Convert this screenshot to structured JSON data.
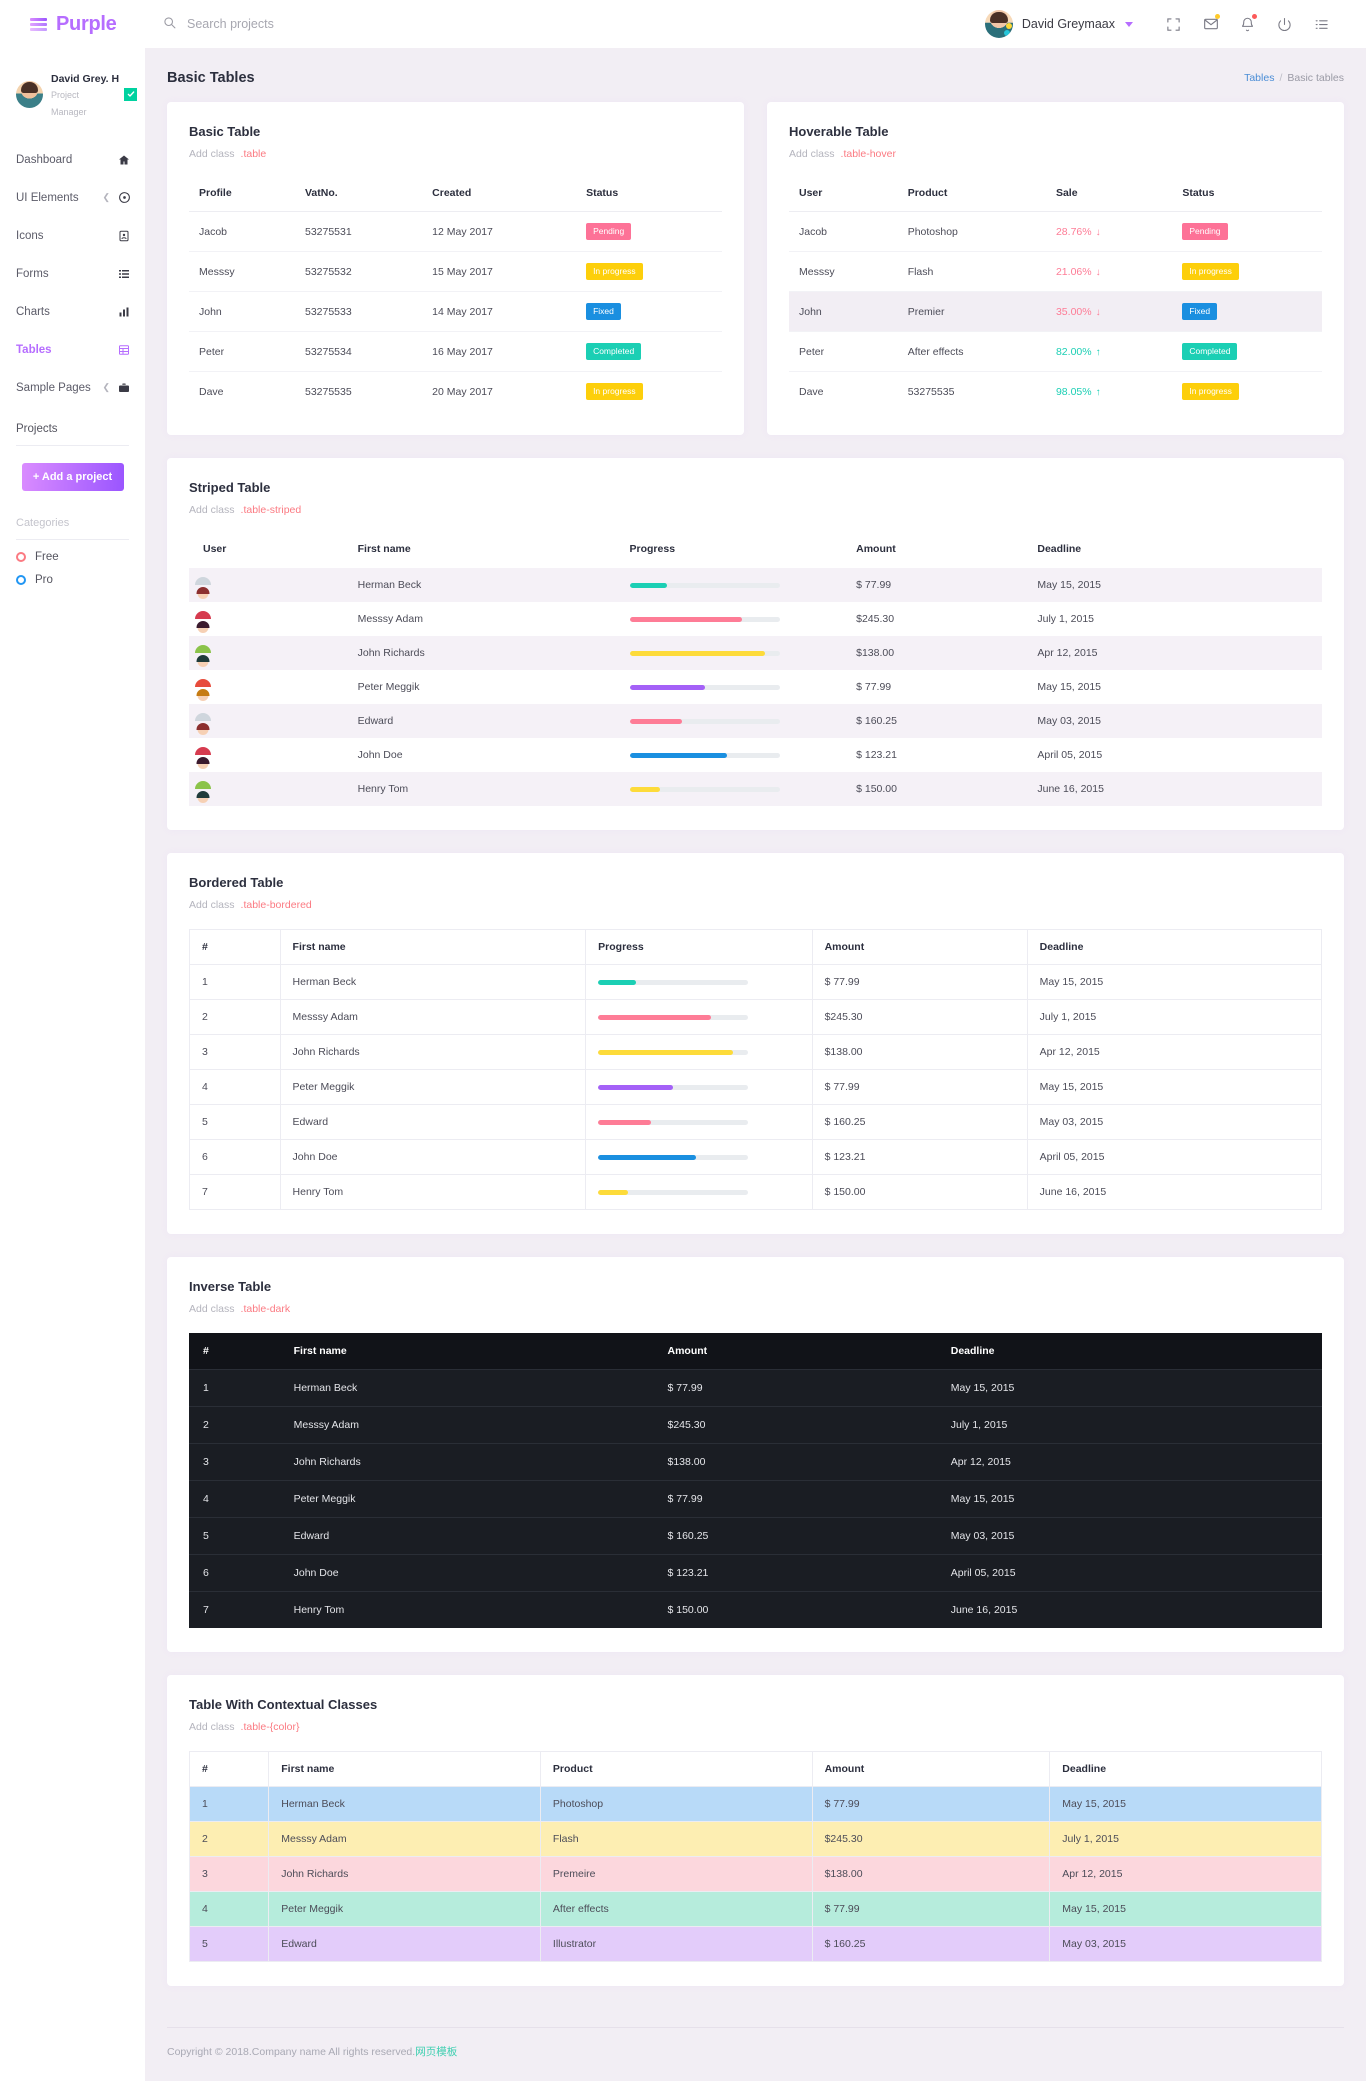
{
  "brand": {
    "name": "Purple"
  },
  "navbar": {
    "search_placeholder": "Search projects",
    "search_value": "",
    "user_name": "David Greymaax",
    "icons": [
      {
        "name": "fullscreen-icon"
      },
      {
        "name": "email-icon",
        "dot": "#ffca2a"
      },
      {
        "name": "bell-icon",
        "dot": "#fc5a5a"
      },
      {
        "name": "power-icon"
      },
      {
        "name": "list-icon"
      }
    ]
  },
  "sidebar": {
    "profile": {
      "name": "David Grey. H",
      "role": "Project Manager"
    },
    "items": [
      {
        "label": "Dashboard",
        "icon": "home-icon",
        "active": false,
        "arrow": false
      },
      {
        "label": "UI Elements",
        "icon": "compass-icon",
        "active": false,
        "arrow": true
      },
      {
        "label": "Icons",
        "icon": "contact-icon",
        "active": false,
        "arrow": false
      },
      {
        "label": "Forms",
        "icon": "form-icon",
        "active": false,
        "arrow": false
      },
      {
        "label": "Charts",
        "icon": "chart-icon",
        "active": false,
        "arrow": false
      },
      {
        "label": "Tables",
        "icon": "table-icon",
        "active": true,
        "arrow": false
      },
      {
        "label": "Sample Pages",
        "icon": "briefcase-icon",
        "active": false,
        "arrow": true
      }
    ],
    "projects_heading": "Projects",
    "add_project_label": "+ Add a project",
    "categories_heading": "Categories",
    "categories": [
      {
        "label": "Free",
        "color": "#fb7a82"
      },
      {
        "label": "Pro",
        "color": "#2196f3"
      }
    ]
  },
  "page": {
    "title": "Basic Tables",
    "breadcrumb": {
      "root": "Tables",
      "sep": "/",
      "current": "Basic tables"
    }
  },
  "basic_table": {
    "title": "Basic Table",
    "sub_label": "Add class",
    "sub_class": ".table",
    "columns": [
      "Profile",
      "VatNo.",
      "Created",
      "Status"
    ],
    "rows": [
      {
        "profile": "Jacob",
        "vat": "53275531",
        "created": "12 May 2017",
        "status": "Pending",
        "status_color": "#fd7297"
      },
      {
        "profile": "Messsy",
        "vat": "53275532",
        "created": "15 May 2017",
        "status": "In progress",
        "status_color": "#fdcf0b"
      },
      {
        "profile": "John",
        "vat": "53275533",
        "created": "14 May 2017",
        "status": "Fixed",
        "status_color": "#1a8fe0"
      },
      {
        "profile": "Peter",
        "vat": "53275534",
        "created": "16 May 2017",
        "status": "Completed",
        "status_color": "#1bcfb4"
      },
      {
        "profile": "Dave",
        "vat": "53275535",
        "created": "20 May 2017",
        "status": "In progress",
        "status_color": "#fdcf0b"
      }
    ]
  },
  "hoverable_table": {
    "title": "Hoverable Table",
    "sub_label": "Add class",
    "sub_class": ".table-hover",
    "columns": [
      "User",
      "Product",
      "Sale",
      "Status"
    ],
    "rows": [
      {
        "user": "Jacob",
        "product": "Photoshop",
        "sale": "28.76%",
        "trend": "down",
        "sale_color": "#fe7c96",
        "status": "Pending",
        "status_color": "#fd7297",
        "hovered": false
      },
      {
        "user": "Messsy",
        "product": "Flash",
        "sale": "21.06%",
        "trend": "down",
        "sale_color": "#fe7c96",
        "status": "In progress",
        "status_color": "#fdcf0b",
        "hovered": false
      },
      {
        "user": "John",
        "product": "Premier",
        "sale": "35.00%",
        "trend": "down",
        "sale_color": "#fe7c96",
        "status": "Fixed",
        "status_color": "#1a8fe0",
        "hovered": true
      },
      {
        "user": "Peter",
        "product": "After effects",
        "sale": "82.00%",
        "trend": "up",
        "sale_color": "#1bcfb4",
        "status": "Completed",
        "status_color": "#1bcfb4",
        "hovered": false
      },
      {
        "user": "Dave",
        "product": "53275535",
        "sale": "98.05%",
        "trend": "up",
        "sale_color": "#1bcfb4",
        "status": "In progress",
        "status_color": "#fdcf0b",
        "hovered": false
      }
    ]
  },
  "striped_table": {
    "title": "Striped Table",
    "sub_label": "Add class",
    "sub_class": ".table-striped",
    "columns": [
      "User",
      "First name",
      "Progress",
      "Amount",
      "Deadline"
    ],
    "rows": [
      {
        "name": "Herman Beck",
        "progress": 25,
        "bar_color": "#1bcfb4",
        "amount": "$ 77.99",
        "deadline": "May 15, 2015",
        "hair": "#8c2f2f",
        "body": "#cfd6dd",
        "bg": "#c0392b"
      },
      {
        "name": "Messsy Adam",
        "progress": 75,
        "bar_color": "#fe7c96",
        "amount": "$245.30",
        "deadline": "July 1, 2015",
        "hair": "#3b1a2e",
        "body": "#d63b4f",
        "bg": "#512d54"
      },
      {
        "name": "John Richards",
        "progress": 90,
        "bar_color": "#fddb3a",
        "amount": "$138.00",
        "deadline": "Apr 12, 2015",
        "hair": "#1f3b3a",
        "body": "#8bc34a",
        "bg": "#16a085"
      },
      {
        "name": "Peter Meggik",
        "progress": 50,
        "bar_color": "#a461f7",
        "amount": "$ 77.99",
        "deadline": "May 15, 2015",
        "hair": "#c67b12",
        "body": "#e74c3c",
        "bg": "#f0a40d"
      },
      {
        "name": "Edward",
        "progress": 35,
        "bar_color": "#fe7c96",
        "amount": "$ 160.25",
        "deadline": "May 03, 2015",
        "hair": "#8c2f2f",
        "body": "#cfd6dd",
        "bg": "#c0392b"
      },
      {
        "name": "John Doe",
        "progress": 65,
        "bar_color": "#1a8fe0",
        "amount": "$ 123.21",
        "deadline": "April 05, 2015",
        "hair": "#3b1a2e",
        "body": "#d63b4f",
        "bg": "#512d54"
      },
      {
        "name": "Henry Tom",
        "progress": 20,
        "bar_color": "#fddb3a",
        "amount": "$ 150.00",
        "deadline": "June 16, 2015",
        "hair": "#1f3b3a",
        "body": "#8bc34a",
        "bg": "#16a085"
      }
    ]
  },
  "bordered_table": {
    "title": "Bordered Table",
    "sub_label": "Add class",
    "sub_class": ".table-bordered",
    "columns": [
      "#",
      "First name",
      "Progress",
      "Amount",
      "Deadline"
    ],
    "rows": [
      {
        "num": "1",
        "name": "Herman Beck",
        "progress": 25,
        "bar_color": "#1bcfb4",
        "amount": "$ 77.99",
        "deadline": "May 15, 2015"
      },
      {
        "num": "2",
        "name": "Messsy Adam",
        "progress": 75,
        "bar_color": "#fe7c96",
        "amount": "$245.30",
        "deadline": "July 1, 2015"
      },
      {
        "num": "3",
        "name": "John Richards",
        "progress": 90,
        "bar_color": "#fddb3a",
        "amount": "$138.00",
        "deadline": "Apr 12, 2015"
      },
      {
        "num": "4",
        "name": "Peter Meggik",
        "progress": 50,
        "bar_color": "#a461f7",
        "amount": "$ 77.99",
        "deadline": "May 15, 2015"
      },
      {
        "num": "5",
        "name": "Edward",
        "progress": 35,
        "bar_color": "#fe7c96",
        "amount": "$ 160.25",
        "deadline": "May 03, 2015"
      },
      {
        "num": "6",
        "name": "John Doe",
        "progress": 65,
        "bar_color": "#1a8fe0",
        "amount": "$ 123.21",
        "deadline": "April 05, 2015"
      },
      {
        "num": "7",
        "name": "Henry Tom",
        "progress": 20,
        "bar_color": "#fddb3a",
        "amount": "$ 150.00",
        "deadline": "June 16, 2015"
      }
    ]
  },
  "inverse_table": {
    "title": "Inverse Table",
    "sub_label": "Add class",
    "sub_class": ".table-dark",
    "columns": [
      "#",
      "First name",
      "Amount",
      "Deadline"
    ],
    "rows": [
      {
        "num": "1",
        "name": "Herman Beck",
        "amount": "$ 77.99",
        "deadline": "May 15, 2015"
      },
      {
        "num": "2",
        "name": "Messsy Adam",
        "amount": "$245.30",
        "deadline": "July 1, 2015"
      },
      {
        "num": "3",
        "name": "John Richards",
        "amount": "$138.00",
        "deadline": "Apr 12, 2015"
      },
      {
        "num": "4",
        "name": "Peter Meggik",
        "amount": "$ 77.99",
        "deadline": "May 15, 2015"
      },
      {
        "num": "5",
        "name": "Edward",
        "amount": "$ 160.25",
        "deadline": "May 03, 2015"
      },
      {
        "num": "6",
        "name": "John Doe",
        "amount": "$ 123.21",
        "deadline": "April 05, 2015"
      },
      {
        "num": "7",
        "name": "Henry Tom",
        "amount": "$ 150.00",
        "deadline": "June 16, 2015"
      }
    ]
  },
  "contextual_table": {
    "title": "Table With Contextual Classes",
    "sub_label": "Add class",
    "sub_class": ".table-{color}",
    "columns": [
      "#",
      "First name",
      "Product",
      "Amount",
      "Deadline"
    ],
    "rows": [
      {
        "num": "1",
        "name": "Herman Beck",
        "product": "Photoshop",
        "amount": "$ 77.99",
        "deadline": "May 15, 2015",
        "bg": "#b8daf8"
      },
      {
        "num": "2",
        "name": "Messsy Adam",
        "product": "Flash",
        "amount": "$245.30",
        "deadline": "July 1, 2015",
        "bg": "#fdeeb2"
      },
      {
        "num": "3",
        "name": "John Richards",
        "product": "Premeire",
        "amount": "$138.00",
        "deadline": "Apr 12, 2015",
        "bg": "#fcd7dd"
      },
      {
        "num": "4",
        "name": "Peter Meggik",
        "product": "After effects",
        "amount": "$ 77.99",
        "deadline": "May 15, 2015",
        "bg": "#b6ecdc"
      },
      {
        "num": "5",
        "name": "Edward",
        "product": "Illustrator",
        "amount": "$ 160.25",
        "deadline": "May 03, 2015",
        "bg": "#e3ccfa"
      }
    ]
  },
  "footer": {
    "copyright": "Copyright © 2018.Company name All rights reserved.",
    "link": "网页模板"
  }
}
